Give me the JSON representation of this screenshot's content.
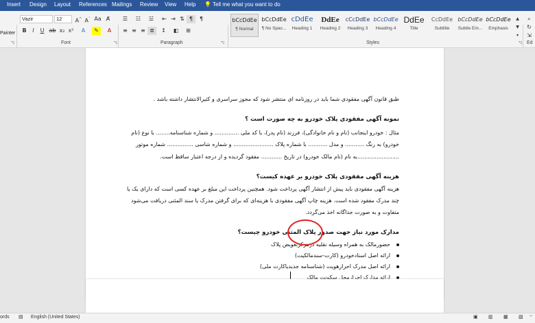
{
  "menu": {
    "tabs": [
      "Insert",
      "Design",
      "Layout",
      "References",
      "Mailings",
      "Review",
      "View",
      "Help"
    ],
    "tell_me": "Tell me what you want to do"
  },
  "ribbon": {
    "clipboard": {
      "painter_label": "Painter"
    },
    "font": {
      "font_name": "Vazir",
      "font_size": "12",
      "group_label": "Font"
    },
    "paragraph": {
      "group_label": "Paragraph"
    },
    "styles": {
      "group_label": "Styles",
      "items": [
        {
          "sample": "bCcDdEe",
          "name": "¶ Normal"
        },
        {
          "sample": "bCcDdEe",
          "name": "¶ No Spac..."
        },
        {
          "sample": "cDdEe",
          "name": "Heading 1"
        },
        {
          "sample": "DdEe",
          "name": "Heading 2"
        },
        {
          "sample": "cCcDdEe",
          "name": "Heading 3"
        },
        {
          "sample": "bCcDdEe",
          "name": "Heading 4"
        },
        {
          "sample": "DdEe",
          "name": "Title"
        },
        {
          "sample": "CcDdEe",
          "name": "Subtitle"
        },
        {
          "sample": "bCcDdEe",
          "name": "Subtle Em..."
        },
        {
          "sample": "bCcDdEe",
          "name": "Emphasis"
        }
      ]
    },
    "editing": {
      "label": "Ed"
    }
  },
  "document": {
    "line_top": "طبق قانون آگهی مفقودی شما باید در روزنامه ای منتشر شود که مجوز سراسری و کثیرالانتشار داشته باشد .",
    "heading1": "نمونه آگهی مفقودی پلاک خودرو به چه صورت است ؟",
    "para1": [
      "مثال : خودرو اینجانب (نام و نام خانوادگی)، فرزند (نام پدر)، با کد ملی .............. و شماره شناسنامه........ با نوع (نام",
      "خودرو) به رنگ ........... و مدل ........... با شماره پلاک ....................... و شماره شاسی ............... شماره موتور",
      "........................به نام (نام مالک خودرو) در تاریخ ............ مفقود گردیده و از درجه اعتبار ساقط است."
    ],
    "heading2": "هزینه آگهی مفقودی پلاک خودرو بر عهده کیست؟",
    "para2": [
      "هزینه آگهی مفقودی باید پیش از انتشار آگهی پرداخت شود. همچنین پرداخت این مبلغ بر عهده کسی است که دارای یک یا",
      "چند مدرک مفقود شده است. هزینه چاپ آگهی مفقودی با هزینه‌ای که برای گرفتن مدرک یا سند المثنی دریافت می‌شود",
      "متفاوت و به صورت جداگانه اخذ می‌گردد."
    ],
    "heading3": "مدارک مورد نیاز جهت صدور پلاک المثنی خودرو چیست؟",
    "bullets": [
      "حضورمالک به همراه وسیله نقلیه درمرکزتعویض پلاک",
      "ارائه اصل اسنادخودرو (کارت-سندمالکیت)",
      "ارائه اصل مدرک احرازهویت (شناسنامه جدیدیاکارت ملی)",
      "ارائه مدارک احرازمحل سکونت مالک"
    ]
  },
  "status": {
    "words": "ords",
    "language": "English (United States)"
  },
  "colors": {
    "menu_bg": "#2b579a",
    "heading1_style": "#2f5496",
    "annotation": "#e02020"
  }
}
